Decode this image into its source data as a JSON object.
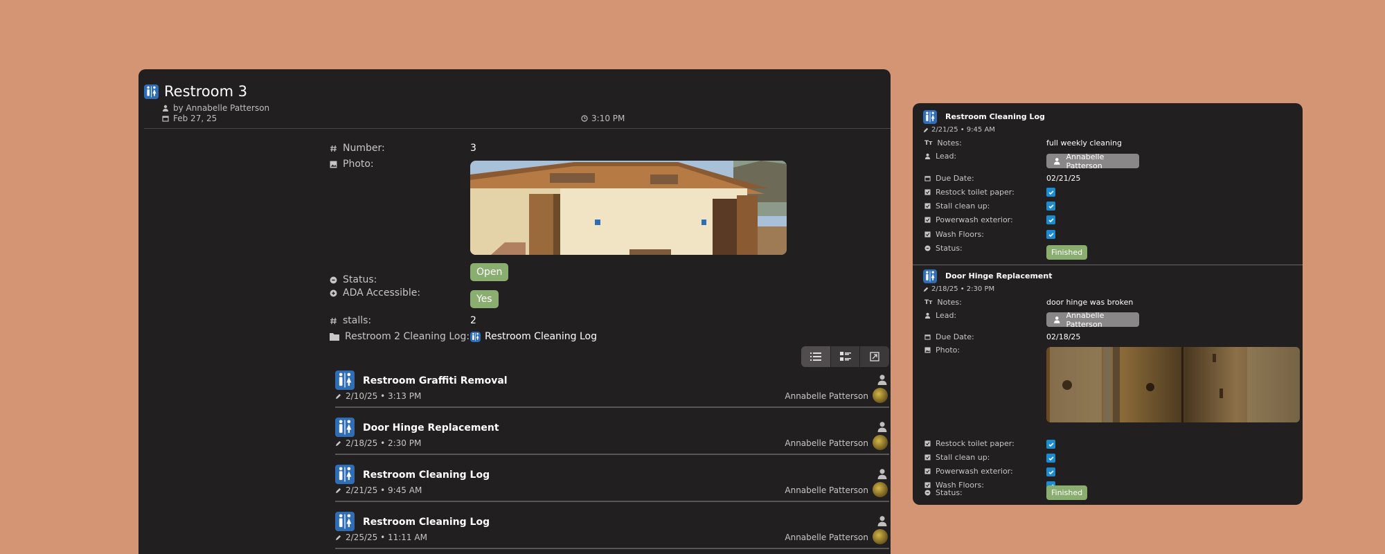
{
  "main": {
    "title": "Restroom 3",
    "author": "by Annabelle Patterson",
    "date": "Feb 27, 25",
    "time": "3:10 PM",
    "fields": {
      "number_label": "Number:",
      "number_value": "3",
      "photo_label": "Photo:",
      "status_label": "Status:",
      "status_value": "Open",
      "ada_label": "ADA Accessible:",
      "ada_value": "Yes",
      "stalls_label": "stalls:",
      "stalls_value": "2",
      "cleaning_log_label": "Restroom 2 Cleaning Log:",
      "cleaning_log_value": "Restroom Cleaning Log"
    },
    "list": [
      {
        "title": "Restroom Graffiti Removal",
        "edited": "2/10/25 • 3:13 PM",
        "author": "Annabelle Patterson"
      },
      {
        "title": "Door Hinge Replacement",
        "edited": "2/18/25 • 2:30 PM",
        "author": "Annabelle Patterson"
      },
      {
        "title": "Restroom Cleaning Log",
        "edited": "2/21/25 • 9:45 AM",
        "author": "Annabelle Patterson"
      },
      {
        "title": "Restroom Cleaning Log",
        "edited": "2/25/25 • 11:11 AM",
        "author": "Annabelle Patterson"
      }
    ]
  },
  "side": {
    "sections": [
      {
        "title": "Restroom Cleaning Log",
        "edited": "2/21/25 • 9:45 AM",
        "notes_label": "Notes:",
        "notes_value": "full weekly cleaning",
        "lead_label": "Lead:",
        "lead_value": "Annabelle Patterson",
        "due_label": "Due Date:",
        "due_value": "02/21/25",
        "checks": [
          {
            "label": "Restock toilet paper:",
            "checked": true
          },
          {
            "label": "Stall clean up:",
            "checked": true
          },
          {
            "label": "Powerwash exterior:",
            "checked": true
          },
          {
            "label": "Wash Floors:",
            "checked": true
          }
        ],
        "status_label": "Status:",
        "status_value": "Finished"
      },
      {
        "title": "Door Hinge Replacement",
        "edited": "2/18/25 • 2:30 PM",
        "notes_label": "Notes:",
        "notes_value": "door hinge was broken",
        "lead_label": "Lead:",
        "lead_value": "Annabelle Patterson",
        "due_label": "Due Date:",
        "due_value": "02/18/25",
        "photo_label": "Photo:",
        "checks": [
          {
            "label": "Restock toilet paper:",
            "checked": true
          },
          {
            "label": "Stall clean up:",
            "checked": true
          },
          {
            "label": "Powerwash exterior:",
            "checked": true
          },
          {
            "label": "Wash Floors:",
            "checked": true
          }
        ],
        "status_label": "Status:",
        "status_value": "Finished"
      }
    ]
  },
  "colors": {
    "background": "#d49575",
    "panel": "#221f20",
    "pill_green": "#8aad70",
    "checkbox_blue": "#1a8ccf",
    "restroom_icon_blue": "#2f6db7"
  },
  "icons": [
    "restroom-icon",
    "person-icon",
    "calendar-icon",
    "clock-icon",
    "hash-icon",
    "image-icon",
    "status-icon",
    "folder-icon",
    "list-view-icon",
    "card-view-icon",
    "expand-icon",
    "pencil-icon",
    "text-icon",
    "checkbox-icon",
    "check-icon"
  ]
}
